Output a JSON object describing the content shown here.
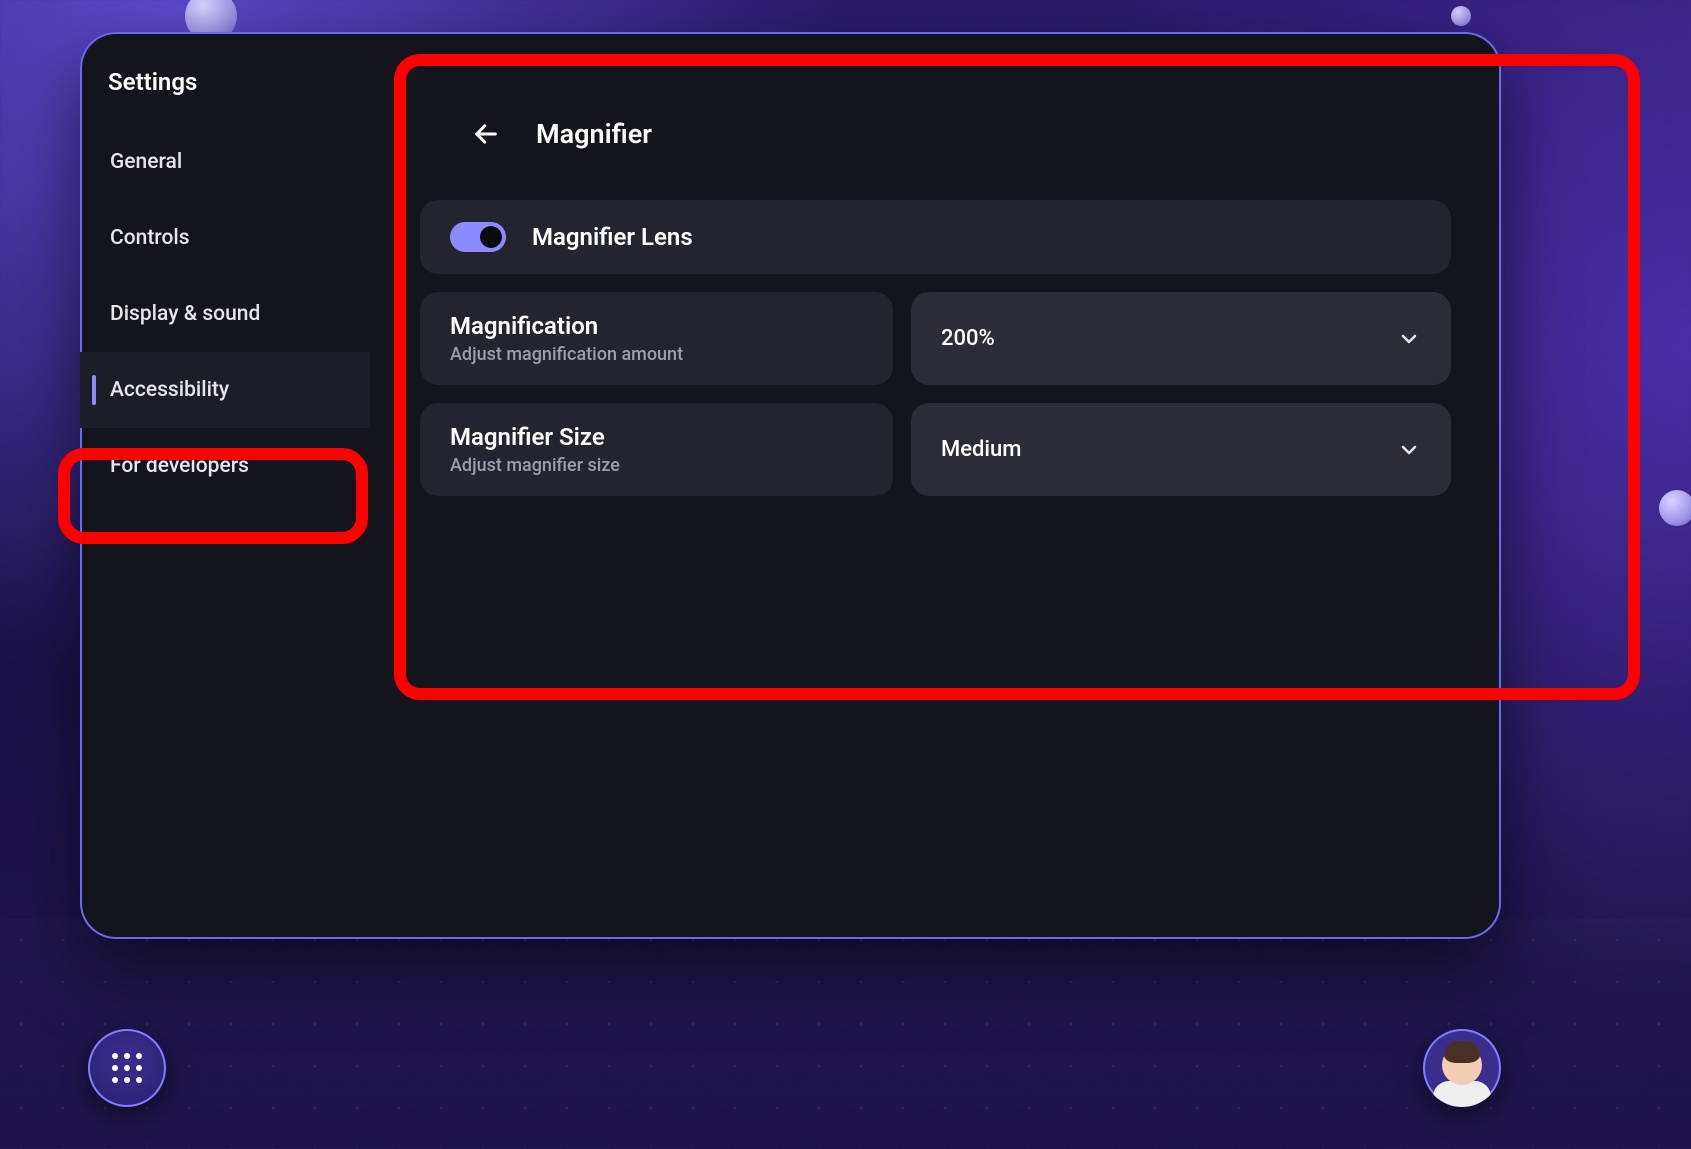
{
  "window": {
    "title": "Settings"
  },
  "sidebar": {
    "items": [
      {
        "label": "General"
      },
      {
        "label": "Controls"
      },
      {
        "label": "Display & sound"
      },
      {
        "label": "Accessibility"
      },
      {
        "label": "For developers"
      }
    ],
    "active_index": 3
  },
  "panel": {
    "title": "Magnifier",
    "toggle": {
      "label": "Magnifier Lens",
      "on": true
    },
    "magnification": {
      "title": "Magnification",
      "subtitle": "Adjust magnification amount",
      "value": "200%"
    },
    "size": {
      "title": "Magnifier Size",
      "subtitle": "Adjust magnifier size",
      "value": "Medium"
    }
  },
  "highlights": {
    "sidebar_item": "Accessibility",
    "panel": "Magnifier"
  },
  "colors": {
    "accent": "#8b8bff",
    "highlight": "#ff0000",
    "card": "#24242e",
    "panel": "#14141c"
  }
}
